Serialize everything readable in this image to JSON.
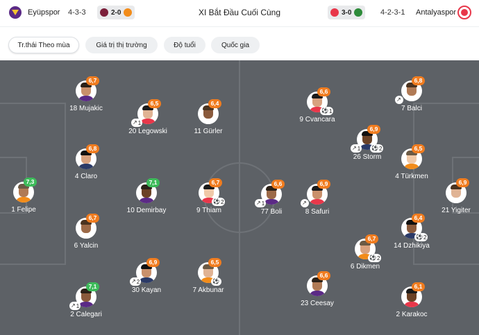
{
  "header": {
    "title": "XI Bắt Đầu Cuối Cùng",
    "home": {
      "name": "Eyüpspor",
      "formation": "4-3-3",
      "last_result": "2-0",
      "logo_color": "#5b2a86",
      "chip_logos": [
        "#7b1f3a",
        "#f28c1a"
      ]
    },
    "away": {
      "name": "Antalyaspor",
      "formation": "4-2-3-1",
      "last_result": "3-0",
      "logo_color": "#e8374a",
      "chip_logos": [
        "#e8374a",
        "#2e8b3a"
      ]
    }
  },
  "tabs": [
    {
      "label": "Tr.thái Theo mùa",
      "active": true
    },
    {
      "label": "Giá trị thị trường",
      "active": false
    },
    {
      "label": "Độ tuổi",
      "active": false
    },
    {
      "label": "Quốc gia",
      "active": false
    }
  ],
  "colors": {
    "rating_orange": "#f07c1f",
    "rating_green": "#3dbb5a",
    "pitch": "#5d6166",
    "pitch_lines": "#6e7277"
  },
  "players": [
    {
      "name": "18 Mujakic",
      "rating": "6,7",
      "tier": "orange",
      "badges": []
    },
    {
      "name": "20 Legowski",
      "rating": "6,5",
      "tier": "orange",
      "badges": [
        {
          "side": "left",
          "icon": "boot-icon",
          "count": "1"
        }
      ]
    },
    {
      "name": "11 Gürler",
      "rating": "6,4",
      "tier": "orange",
      "badges": []
    },
    {
      "name": "4 Claro",
      "rating": "6,8",
      "tier": "orange",
      "badges": []
    },
    {
      "name": "1 Felipe",
      "rating": "7,3",
      "tier": "green",
      "badges": []
    },
    {
      "name": "10 Demirbay",
      "rating": "7,1",
      "tier": "green",
      "badges": []
    },
    {
      "name": "9 Thiam",
      "rating": "6,7",
      "tier": "orange",
      "badges": [
        {
          "side": "right",
          "icon": "ball-icon",
          "count": "2"
        }
      ]
    },
    {
      "name": "6 Yalcin",
      "rating": "6,7",
      "tier": "orange",
      "badges": []
    },
    {
      "name": "30 Kayan",
      "rating": "6,9",
      "tier": "orange",
      "badges": [
        {
          "side": "left",
          "icon": "boot-icon",
          "count": "2"
        }
      ]
    },
    {
      "name": "7 Akbunar",
      "rating": "6,5",
      "tier": "orange",
      "badges": [
        {
          "side": "right",
          "icon": "ball-icon",
          "count": ""
        }
      ]
    },
    {
      "name": "2 Calegari",
      "rating": "7,1",
      "tier": "green",
      "badges": [
        {
          "side": "left",
          "icon": "boot-icon",
          "count": "1"
        }
      ]
    },
    {
      "name": "9 Cvancara",
      "rating": "6,6",
      "tier": "orange",
      "badges": [
        {
          "side": "right",
          "icon": "ball-icon",
          "count": "1"
        }
      ]
    },
    {
      "name": "7 Balci",
      "rating": "6,8",
      "tier": "orange",
      "badges": [
        {
          "side": "left",
          "icon": "boot-icon",
          "count": ""
        }
      ]
    },
    {
      "name": "26 Storm",
      "rating": "6,9",
      "tier": "orange",
      "badges": [
        {
          "side": "left",
          "icon": "boot-icon",
          "count": "1"
        },
        {
          "side": "right",
          "icon": "ball-icon",
          "count": "2"
        }
      ]
    },
    {
      "name": "4 Türkmen",
      "rating": "6,5",
      "tier": "orange",
      "badges": []
    },
    {
      "name": "77 Boli",
      "rating": "6,6",
      "tier": "orange",
      "badges": [
        {
          "side": "left",
          "icon": "boot-icon",
          "count": "1"
        }
      ]
    },
    {
      "name": "8 Safuri",
      "rating": "6,9",
      "tier": "orange",
      "badges": [
        {
          "side": "left",
          "icon": "boot-icon",
          "count": ""
        }
      ]
    },
    {
      "name": "21 Yigiter",
      "rating": "6,9",
      "tier": "orange",
      "badges": []
    },
    {
      "name": "14 Dzhikiya",
      "rating": "6,4",
      "tier": "orange",
      "badges": [
        {
          "side": "right",
          "icon": "ball-icon",
          "count": "2"
        }
      ]
    },
    {
      "name": "6 Dikmen",
      "rating": "6,7",
      "tier": "orange",
      "badges": [
        {
          "side": "right",
          "icon": "ball-icon",
          "count": "2"
        }
      ]
    },
    {
      "name": "23 Ceesay",
      "rating": "6,6",
      "tier": "orange",
      "badges": []
    },
    {
      "name": "2 Karakoc",
      "rating": "6,1",
      "tier": "orange",
      "badges": []
    }
  ]
}
